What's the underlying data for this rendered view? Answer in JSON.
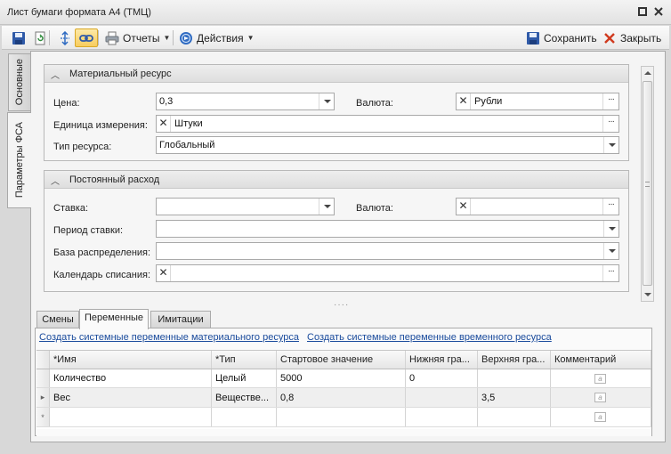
{
  "window": {
    "title": "Лист бумаги формата А4 (ТМЦ)"
  },
  "toolbar": {
    "reports_label": "Отчеты",
    "actions_label": "Действия",
    "save_label": "Сохранить",
    "close_label": "Закрыть"
  },
  "side_tabs": [
    {
      "label": "Основные"
    },
    {
      "label": "Параметры ФСА"
    }
  ],
  "material_group": {
    "title": "Материальный ресурс",
    "price_label": "Цена:",
    "price_value": "0,3",
    "currency_label": "Валюта:",
    "currency_value": "Рубли",
    "unit_label": "Единица измерения:",
    "unit_value": "Штуки",
    "resource_type_label": "Тип ресурса:",
    "resource_type_value": "Глобальный"
  },
  "fixed_group": {
    "title": "Постоянный расход",
    "rate_label": "Ставка:",
    "rate_value": "",
    "currency_label": "Валюта:",
    "currency_value": "",
    "period_label": "Период ставки:",
    "period_value": "",
    "distribution_label": "База распределения:",
    "distribution_value": "",
    "calendar_label": "Календарь списания:",
    "calendar_value": ""
  },
  "bottom_tabs": [
    {
      "label": "Смены"
    },
    {
      "label": "Переменные"
    },
    {
      "label": "Имитации"
    }
  ],
  "links": {
    "create_material": "Создать системные переменные материального ресурса",
    "create_time": "Создать системные переменные временного ресурса"
  },
  "grid": {
    "columns": [
      "*Имя",
      "*Тип",
      "Стартовое значение",
      "Нижняя гра...",
      "Верхняя гра...",
      "Комментарий"
    ],
    "rows": [
      {
        "name": "Количество",
        "type": "Целый",
        "start": "5000",
        "lower": "0",
        "upper": "",
        "comment": ""
      },
      {
        "name": "Вес",
        "type": "Веществе...",
        "start": "0,8",
        "lower": "",
        "upper": "3,5",
        "comment": ""
      }
    ],
    "new_row_marker": "*",
    "current_row_marker": "▸",
    "memo_glyph": "a"
  },
  "colors": {
    "link": "#1a4b9c",
    "active_tool": "#f8cd5e",
    "close_x": "#d03a1e"
  }
}
